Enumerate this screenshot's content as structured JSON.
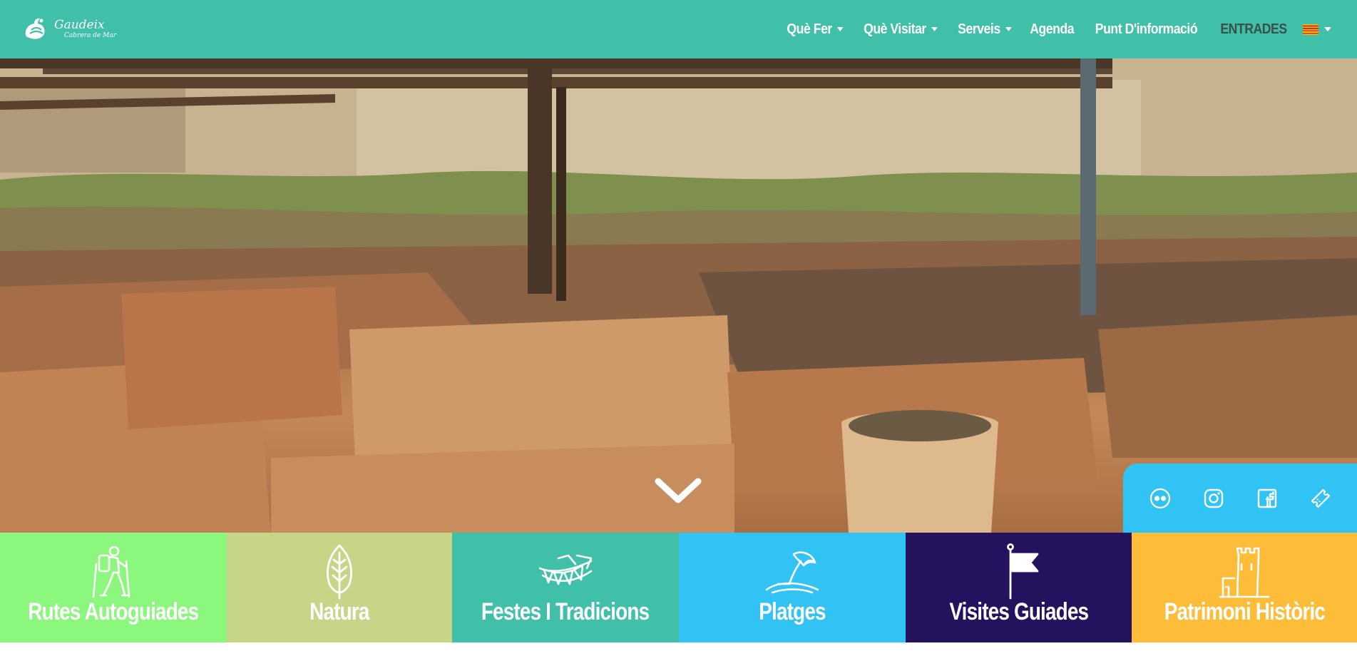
{
  "header": {
    "logo": {
      "name": "Gaudeix",
      "subtitle": "Cabrera de Mar"
    },
    "nav": [
      {
        "label": "Què Fer",
        "has_dropdown": true
      },
      {
        "label": "Què Visitar",
        "has_dropdown": true
      },
      {
        "label": "Serveis",
        "has_dropdown": true
      },
      {
        "label": "Agenda",
        "has_dropdown": false
      },
      {
        "label": "Punt D'informació",
        "has_dropdown": false
      },
      {
        "label": "ENTRADES",
        "has_dropdown": false
      }
    ],
    "language_flag": "catalonia-flag-icon"
  },
  "hero": {
    "scroll_icon": "chevron-down-icon"
  },
  "social": [
    {
      "icon": "flickr-icon"
    },
    {
      "icon": "instagram-icon"
    },
    {
      "icon": "facebook-icon"
    },
    {
      "icon": "ticket-icon"
    }
  ],
  "tiles": [
    {
      "label": "Rutes Autoguiades",
      "icon": "hiker-icon",
      "color": "#8bf77d"
    },
    {
      "label": "Natura",
      "icon": "leaf-icon",
      "color": "#c6d686"
    },
    {
      "label": "Festes I Tradicions",
      "icon": "bunting-icon",
      "color": "#40bfa9"
    },
    {
      "label": "Platges",
      "icon": "beach-umbrella-icon",
      "color": "#30c3f4"
    },
    {
      "label": "Visites Guiades",
      "icon": "flag-icon",
      "color": "#24125e"
    },
    {
      "label": "Patrimoni Històric",
      "icon": "tower-icon",
      "color": "#fdbd39"
    }
  ],
  "colors": {
    "header_bg": "#40bfa9",
    "social_bg": "#30c3f4",
    "nav_text": "#ffffff",
    "nav_highlight_text": "#3b4f4b"
  }
}
